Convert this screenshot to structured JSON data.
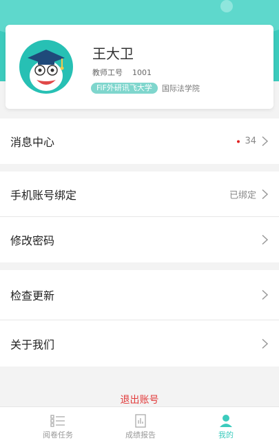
{
  "profile": {
    "name": "王大卫",
    "staff_label": "教师工号",
    "staff_no": "1001",
    "school": "FiF外研讯飞大学",
    "department": "国际法学院"
  },
  "menu": {
    "messages": {
      "label": "消息中心",
      "count": "34"
    },
    "bind_phone": {
      "label": "手机账号绑定",
      "status": "已绑定"
    },
    "change_password": {
      "label": "修改密码"
    },
    "check_update": {
      "label": "检查更新"
    },
    "about": {
      "label": "关于我们"
    }
  },
  "logout_label": "退出账号",
  "tabbar": {
    "read_tasks": "阅卷任务",
    "report": "成绩报告",
    "mine": "我的"
  },
  "colors": {
    "accent": "#3ccbbd",
    "logout_red": "#e23b3b",
    "badge_dot": "#e02020"
  }
}
